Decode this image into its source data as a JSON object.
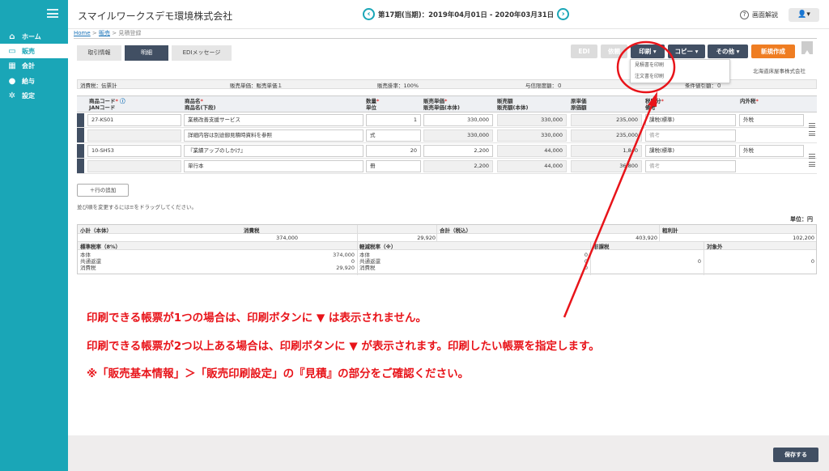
{
  "sidebar": {
    "items": [
      {
        "label": "ホーム"
      },
      {
        "label": "販売"
      },
      {
        "label": "会計"
      },
      {
        "label": "給与"
      },
      {
        "label": "設定"
      }
    ]
  },
  "header": {
    "company": "スマイルワークスデモ環境株式会社",
    "period": "第17期(当期)：2019年04月01日 - 2020年03月31日",
    "help": "画面解説"
  },
  "breadcrumb": {
    "home": "Home",
    "sales": "販売",
    "current": "見積登録"
  },
  "tabs": [
    "取引情報",
    "明細",
    "EDIメッセージ"
  ],
  "buttons": {
    "edi": "EDI",
    "confirm": "依頼",
    "print": "印刷 ▾",
    "copy": "コピー ▾",
    "other": "その他 ▾",
    "new": "新規作成"
  },
  "print_menu": [
    "見積書を印刷",
    "注文書を印刷"
  ],
  "supplier": "北海道床屋事株式会社",
  "info": {
    "tax": "消費税：伝票計",
    "price": "販売単価：販売単価１",
    "rate": "販売掛率：100%",
    "limit": "与信限度額：０",
    "discount": "条件値引額：０"
  },
  "columns": {
    "code": "商品コード",
    "jan": "JANコード",
    "name": "商品名",
    "name2": "商品名(下段)",
    "qty": "数量",
    "unit": "単位",
    "price": "販売単価",
    "price2": "販売単価(本体)",
    "amount": "販売額",
    "amount2": "販売額(本体)",
    "cost": "原単価",
    "cost2": "原価額",
    "taxcat": "税区分",
    "memo": "備考",
    "intax": "内外税"
  },
  "rows": [
    {
      "code": "27-KS01",
      "name": "業務改善支援サービス",
      "name2": "詳細内容は別途御見積時資料を参照",
      "qty": "1",
      "unit": "式",
      "price": "330,000",
      "price2": "330,000",
      "amount": "330,000",
      "amount2": "330,000",
      "cost": "235,000",
      "cost2": "235,000",
      "taxcat": "課税(標準)",
      "memo": "備考",
      "intax": "外税"
    },
    {
      "code": "10-SH53",
      "name": "『業績アップのしかけ』",
      "name2": "単行本",
      "qty": "20",
      "unit": "冊",
      "price": "2,200",
      "price2": "2,200",
      "amount": "44,000",
      "amount2": "44,000",
      "cost": "1,840",
      "cost2": "36,800",
      "taxcat": "課税(標準)",
      "memo": "備考",
      "intax": "外税"
    }
  ],
  "add_row": "＋行の追加",
  "sort_hint": "並び順を変更するには≡をドラッグしてください。",
  "unit_label": "単位：円",
  "summary": {
    "subtotal_label": "小計（本体）",
    "subtotal": "374,000",
    "tax_label": "消費税",
    "tax": "29,920",
    "total_label": "合計（税込）",
    "total": "403,920",
    "profit_label": "粗利計",
    "profit": "102,200",
    "std_label": "標準税率（8%）",
    "reduced_label": "軽減税率（※）",
    "exempt_label": "非課税",
    "nontax_label": "対象外",
    "body_label": "本体",
    "common_label": "共通返還",
    "ctax_label": "消費税",
    "std_body": "374,000",
    "std_common": "0",
    "std_tax": "29,920",
    "red_body": "0",
    "red_common": "0",
    "red_tax": "0",
    "exempt_val": "0",
    "nontax_val": "0"
  },
  "notes": [
    "印刷できる帳票が1つの場合は、印刷ボタンに ▼ は表示されません。",
    "印刷できる帳票が2つ以上ある場合は、印刷ボタンに ▼ が表示されます。印刷したい帳票を指定します。",
    "※「販売基本情報」＞「販売印刷設定」の『見積』の部分をご確認ください。"
  ],
  "save": "保存する",
  "colors": {
    "sidebar": "#1aa6b7",
    "dark": "#414f63",
    "orange": "#ef7d22",
    "annotation": "#e8141a"
  }
}
